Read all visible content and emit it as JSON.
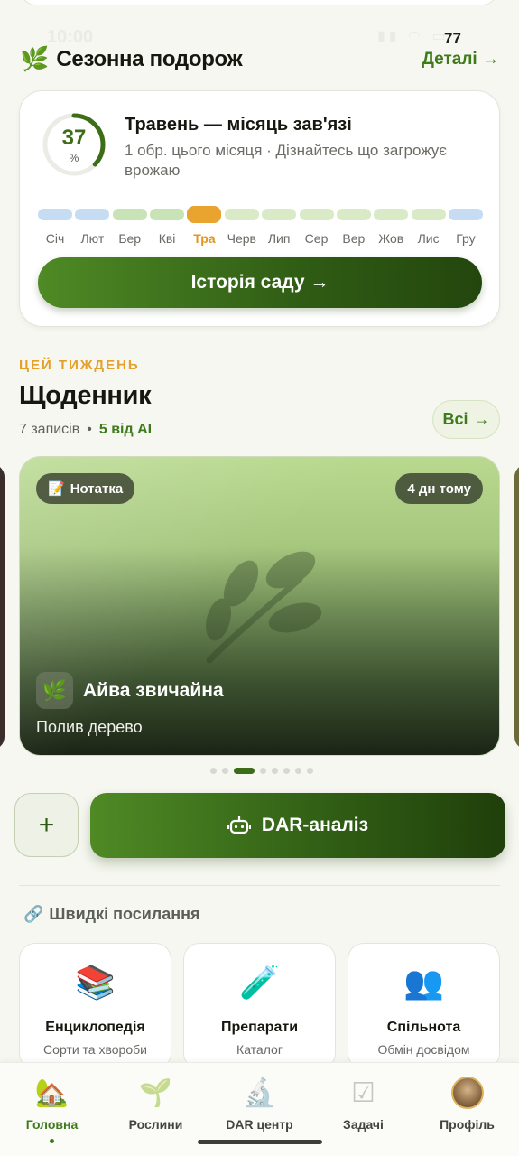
{
  "status_bar": {
    "time": "10:00",
    "badge": "77"
  },
  "seasonal": {
    "title": "Сезонна подорож",
    "details_link": "Деталі →",
    "progress_value": "37",
    "progress_unit": "%",
    "month_title": "Травень — місяць зав'язі",
    "month_subtitle": "1 обр. цього місяця · Дізнайтесь що загрожує врожаю",
    "months": [
      "Січ",
      "Лют",
      "Бер",
      "Кві",
      "Тра",
      "Черв",
      "Лип",
      "Сер",
      "Вер",
      "Жов",
      "Лис",
      "Гру"
    ],
    "active_month_index": 4,
    "history_button": "Історія саду →",
    "colors": {
      "winter": "#c6dcf2",
      "spring": "#c8e3b5",
      "summer": "#d8ebc6",
      "active": "#e8a42e",
      "accent": "#3f7a1c"
    }
  },
  "diary": {
    "kicker": "ЦЕЙ ТИЖДЕНЬ",
    "title": "Щоденник",
    "entries_count": "7 записів",
    "ai_count": "5 від AI",
    "all_button": "Всі",
    "card": {
      "type_chip": "Нотатка",
      "time_chip": "4 дн тому",
      "plant_name": "Айва звичайна",
      "action": "Полив дерево"
    },
    "pagination": {
      "total": 8,
      "active": 2
    }
  },
  "actions": {
    "add_label": "+",
    "dar_label": "DAR-аналіз"
  },
  "quick_links": {
    "title": "Швидкі посилання",
    "items": [
      {
        "icon": "books-icon",
        "glyph": "📚",
        "title": "Енциклопедія",
        "subtitle": "Сорти та хвороби"
      },
      {
        "icon": "test-tube-icon",
        "glyph": "🧪",
        "title": "Препарати",
        "subtitle": "Каталог"
      },
      {
        "icon": "people-icon",
        "glyph": "👥",
        "title": "Спільнота",
        "subtitle": "Обмін досвідом"
      }
    ]
  },
  "bottom_nav": [
    {
      "icon": "home-icon",
      "glyph": "🏡",
      "label": "Головна",
      "active": true
    },
    {
      "icon": "seedling-icon",
      "glyph": "🌱",
      "label": "Рослини",
      "active": false
    },
    {
      "icon": "microscope-icon",
      "glyph": "🔬",
      "label": "DAR центр",
      "active": false
    },
    {
      "icon": "checklist-icon",
      "glyph": "☑",
      "label": "Задачі",
      "active": false
    },
    {
      "icon": "avatar-icon",
      "glyph": "",
      "label": "Профіль",
      "active": false
    }
  ]
}
